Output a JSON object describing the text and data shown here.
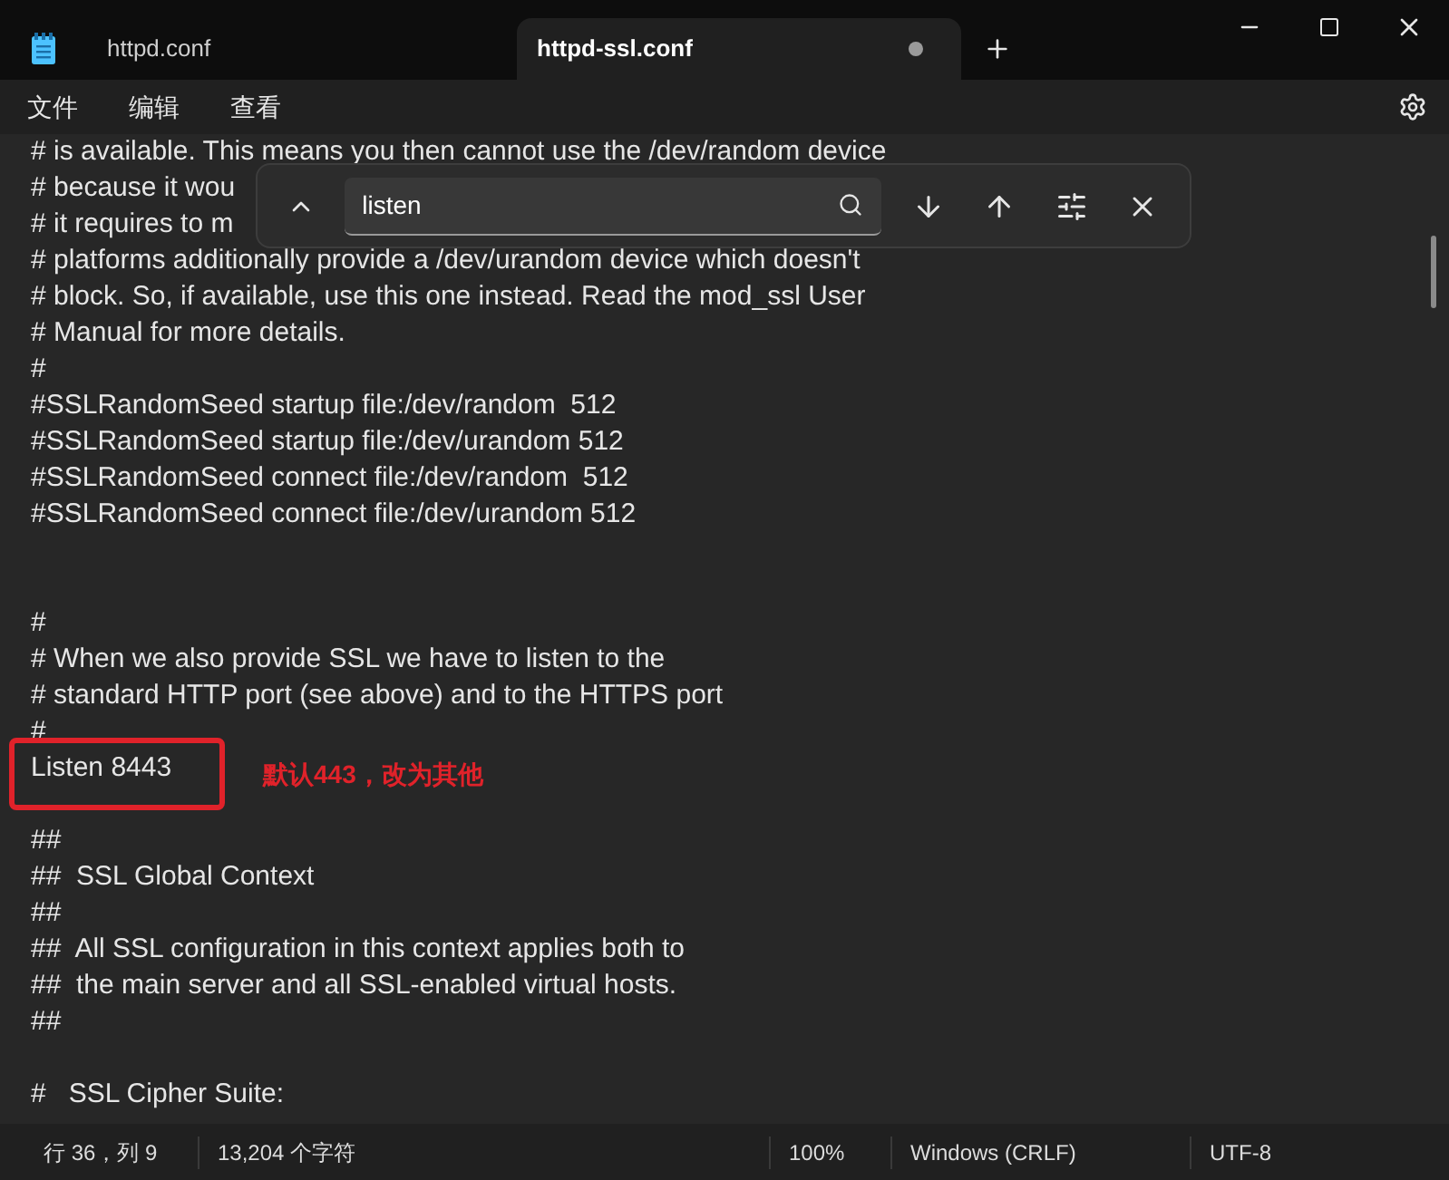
{
  "tabs": [
    {
      "label": "httpd.conf",
      "selected": false,
      "modified": false
    },
    {
      "label": "httpd-ssl.conf",
      "selected": true,
      "modified": true
    }
  ],
  "menu": [
    "文件",
    "编辑",
    "查看"
  ],
  "find": {
    "value": "listen"
  },
  "lines": [
    {
      "kind": "text",
      "text": "# is available. This means you then cannot use the /dev/random device"
    },
    {
      "kind": "text",
      "text": "# because it wou"
    },
    {
      "kind": "text",
      "text": "# it requires to m"
    },
    {
      "kind": "text",
      "text": "# platforms additionally provide a /dev/urandom device which doesn't"
    },
    {
      "kind": "text",
      "text": "# block. So, if available, use this one instead. Read the mod_ssl User"
    },
    {
      "kind": "text",
      "text": "# Manual for more details."
    },
    {
      "kind": "text",
      "text": "#"
    },
    {
      "kind": "text",
      "text": "#SSLRandomSeed startup file:/dev/random  512"
    },
    {
      "kind": "text",
      "text": "#SSLRandomSeed startup file:/dev/urandom 512"
    },
    {
      "kind": "text",
      "text": "#SSLRandomSeed connect file:/dev/random  512"
    },
    {
      "kind": "text",
      "text": "#SSLRandomSeed connect file:/dev/urandom 512"
    },
    {
      "kind": "blank"
    },
    {
      "kind": "blank"
    },
    {
      "kind": "text",
      "text": "#"
    },
    {
      "kind": "text",
      "text": "# When we also provide SSL we have to listen to the"
    },
    {
      "kind": "text",
      "text": "# standard HTTP port (see above) and to the HTTPS port"
    },
    {
      "kind": "text",
      "text": "#"
    },
    {
      "kind": "text",
      "text": "Listen 8443"
    },
    {
      "kind": "blank"
    },
    {
      "kind": "text",
      "text": "##"
    },
    {
      "kind": "text",
      "text": "##  SSL Global Context"
    },
    {
      "kind": "text",
      "text": "##"
    },
    {
      "kind": "text",
      "text": "##  All SSL configuration in this context applies both to"
    },
    {
      "kind": "text",
      "text": "##  the main server and all SSL-enabled virtual hosts."
    },
    {
      "kind": "text",
      "text": "##"
    },
    {
      "kind": "blank"
    },
    {
      "kind": "text",
      "text": "#   SSL Cipher Suite:"
    }
  ],
  "annotation": {
    "note": "默认443，改为其他"
  },
  "status_bar": [
    "行 36，列 9",
    "13,204 个字符",
    "100%",
    "Windows (CRLF)",
    "UTF-8"
  ]
}
